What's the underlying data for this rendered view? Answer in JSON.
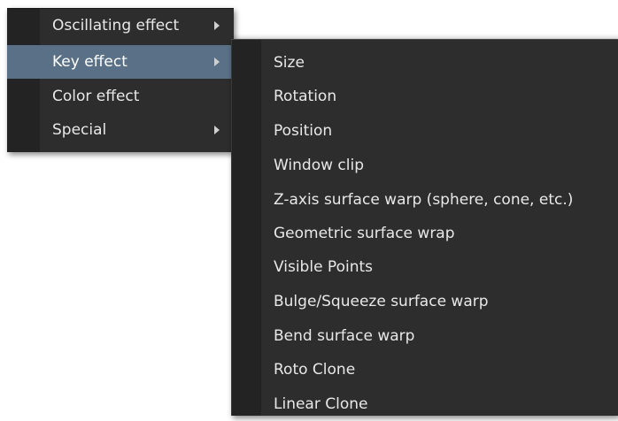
{
  "main_menu": {
    "items": [
      {
        "label": "Oscillating effect",
        "has_submenu": true,
        "highlighted": false
      },
      {
        "label": "Key effect",
        "has_submenu": true,
        "highlighted": true
      },
      {
        "label": "Color effect",
        "has_submenu": false,
        "highlighted": false
      },
      {
        "label": "Special",
        "has_submenu": true,
        "highlighted": false
      }
    ]
  },
  "submenu": {
    "parent": "Key effect",
    "items": [
      {
        "label": "Size"
      },
      {
        "label": "Rotation"
      },
      {
        "label": "Position"
      },
      {
        "label": "Window clip"
      },
      {
        "label": "Z-axis surface warp (sphere, cone, etc.)"
      },
      {
        "label": "Geometric surface wrap"
      },
      {
        "label": "Visible Points"
      },
      {
        "label": "Bulge/Squeeze surface warp"
      },
      {
        "label": "Bend surface warp"
      },
      {
        "label": "Roto Clone"
      },
      {
        "label": "Linear Clone"
      }
    ]
  },
  "colors": {
    "menu_background": "#2d2d2d",
    "gutter": "#232323",
    "highlight": "#5a7086",
    "text": "#e8e8e8",
    "arrow": "#cfcfcf"
  },
  "icons": {
    "submenu_indicator": "chevron-right-icon"
  }
}
